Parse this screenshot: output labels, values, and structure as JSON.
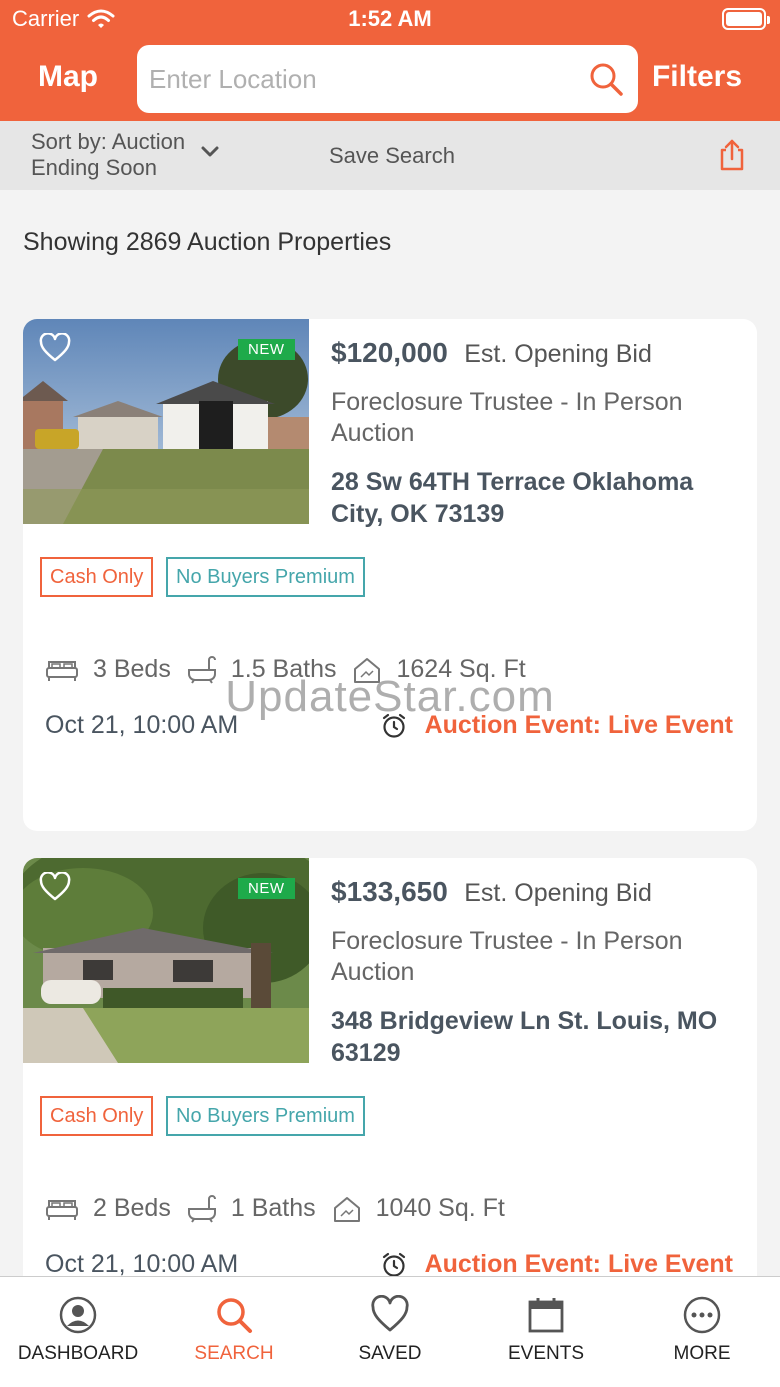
{
  "status": {
    "carrier": "Carrier",
    "time": "1:52 AM"
  },
  "header": {
    "map_label": "Map",
    "search_placeholder": "Enter Location",
    "filters_label": "Filters"
  },
  "sort_bar": {
    "sort_label": "Sort by: Auction Ending Soon",
    "save_search_label": "Save Search"
  },
  "results": {
    "count_text": "Showing 2869 Auction Properties"
  },
  "listings": [
    {
      "badge": "NEW",
      "price": "$120,000",
      "price_label": "Est. Opening Bid",
      "auction_type": "Foreclosure Trustee - In Person Auction",
      "address": "28 Sw 64TH Terrace Oklahoma City, OK 73139",
      "tags": [
        "Cash Only",
        "No Buyers Premium"
      ],
      "beds": "3 Beds",
      "baths": "1.5 Baths",
      "sqft": "1624 Sq. Ft",
      "date": "Oct 21, 10:00 AM",
      "event": "Auction Event: Live Event"
    },
    {
      "badge": "NEW",
      "price": "$133,650",
      "price_label": "Est. Opening Bid",
      "auction_type": "Foreclosure Trustee - In Person Auction",
      "address": "348 Bridgeview Ln St. Louis, MO 63129",
      "tags": [
        "Cash Only",
        "No Buyers Premium"
      ],
      "beds": "2 Beds",
      "baths": "1 Baths",
      "sqft": "1040 Sq. Ft",
      "date": "Oct 21, 10:00 AM",
      "event": "Auction Event: Live Event"
    }
  ],
  "watermark": "UpdateStar.com",
  "tabs": [
    {
      "label": "DASHBOARD",
      "icon": "user-circle-icon"
    },
    {
      "label": "SEARCH",
      "icon": "search-icon",
      "active": true
    },
    {
      "label": "SAVED",
      "icon": "heart-icon"
    },
    {
      "label": "EVENTS",
      "icon": "calendar-icon"
    },
    {
      "label": "MORE",
      "icon": "more-icon"
    }
  ],
  "colors": {
    "brand": "#f0633c",
    "tag_teal": "#45a6ab",
    "new_green": "#1eaa4a",
    "text_dark": "#4a5560"
  }
}
